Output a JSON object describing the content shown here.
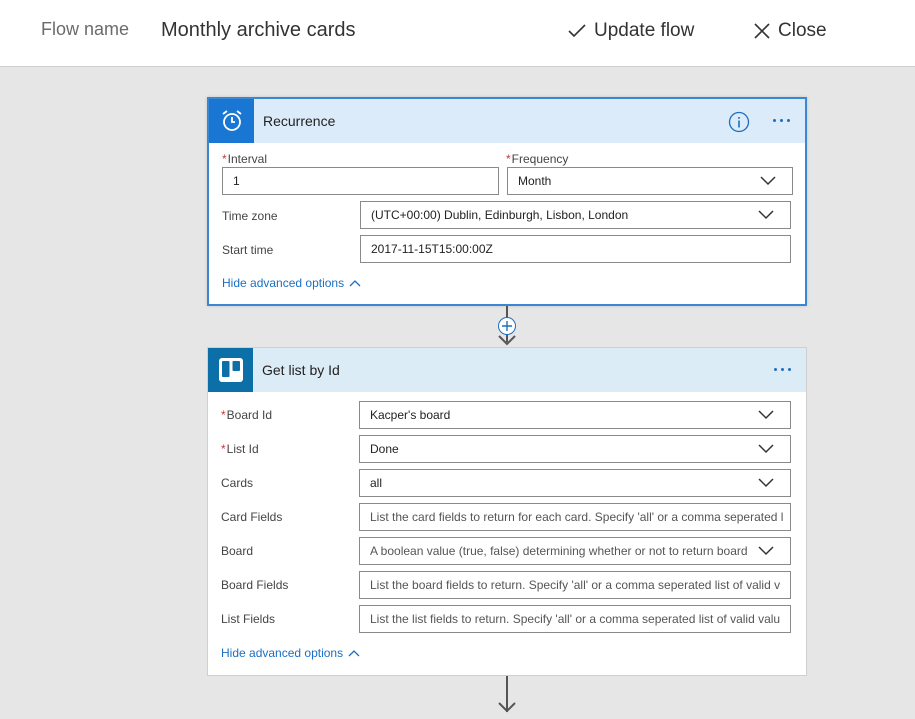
{
  "header": {
    "flow_name_label": "Flow name",
    "flow_name_value": "Monthly archive cards",
    "update_label": "Update flow",
    "close_label": "Close"
  },
  "recurrence": {
    "title": "Recurrence",
    "interval_label": "Interval",
    "interval_value": "1",
    "frequency_label": "Frequency",
    "frequency_value": "Month",
    "timezone_label": "Time zone",
    "timezone_value": "(UTC+00:00) Dublin, Edinburgh, Lisbon, London",
    "start_label": "Start time",
    "start_value": "2017-11-15T15:00:00Z",
    "advanced_link": "Hide advanced options"
  },
  "get_list": {
    "title": "Get list by Id",
    "board_id_label": "Board Id",
    "board_id_value": "Kacper's board",
    "list_id_label": "List Id",
    "list_id_value": "Done",
    "cards_label": "Cards",
    "cards_value": "all",
    "card_fields_label": "Card Fields",
    "card_fields_placeholder": "List the card fields to return for each card. Specify 'all' or a comma seperated l",
    "board_label": "Board",
    "board_placeholder": "A boolean value (true, false) determining whether or not to return board",
    "board_fields_label": "Board Fields",
    "board_fields_placeholder": "List the board fields to return. Specify 'all' or a comma seperated list of valid v",
    "list_fields_label": "List Fields",
    "list_fields_placeholder": "List the list fields to return. Specify 'all' or a comma seperated list of valid valu",
    "advanced_link": "Hide advanced options"
  },
  "colors": {
    "accent": "#1c6fc1",
    "recurrence_icon_bg": "#1976d2",
    "trello_icon_bg": "#0d6fa8",
    "required_mark": "#d13438"
  },
  "icons": {
    "update": "check-icon",
    "close": "close-icon",
    "recurrence": "alarm-clock-icon",
    "trello": "trello-icon",
    "info": "info-icon",
    "more": "more-icon",
    "add_step": "plus-icon"
  }
}
